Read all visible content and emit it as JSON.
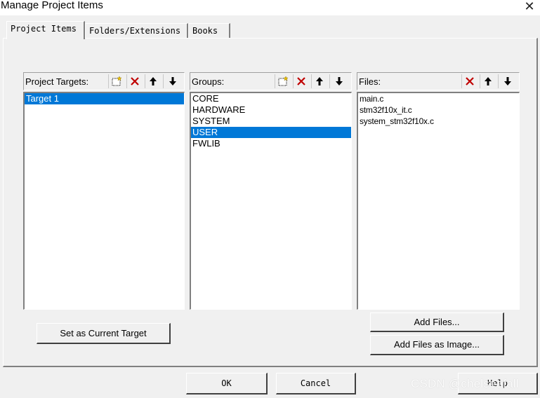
{
  "window": {
    "title": "Manage Project Items"
  },
  "tabs": [
    {
      "label": "Project Items"
    },
    {
      "label": "Folders/Extensions"
    },
    {
      "label": "Books"
    }
  ],
  "targets": {
    "label": "Project Targets:",
    "items": [
      "Target 1"
    ],
    "selected": "Target 1"
  },
  "groups": {
    "label": "Groups:",
    "items": [
      "CORE",
      "HARDWARE",
      "SYSTEM",
      "USER",
      "FWLIB"
    ],
    "selected": "USER"
  },
  "files": {
    "label": "Files:",
    "items": [
      "main.c",
      "stm32f10x_it.c",
      "system_stm32f10x.c"
    ]
  },
  "buttons": {
    "set_current_target": "Set as Current Target",
    "add_files": "Add Files...",
    "add_files_as_image": "Add Files as Image...",
    "ok": "OK",
    "cancel": "Cancel",
    "help": "Help"
  },
  "icons": {
    "new": "new-item-icon",
    "delete": "delete-icon",
    "up": "move-up-icon",
    "down": "move-down-icon",
    "delete_color": "#c00000"
  },
  "colors": {
    "selection": "#0078d7",
    "dialog": "#f0f0f0"
  },
  "watermark": "CSDN @chelseafall"
}
